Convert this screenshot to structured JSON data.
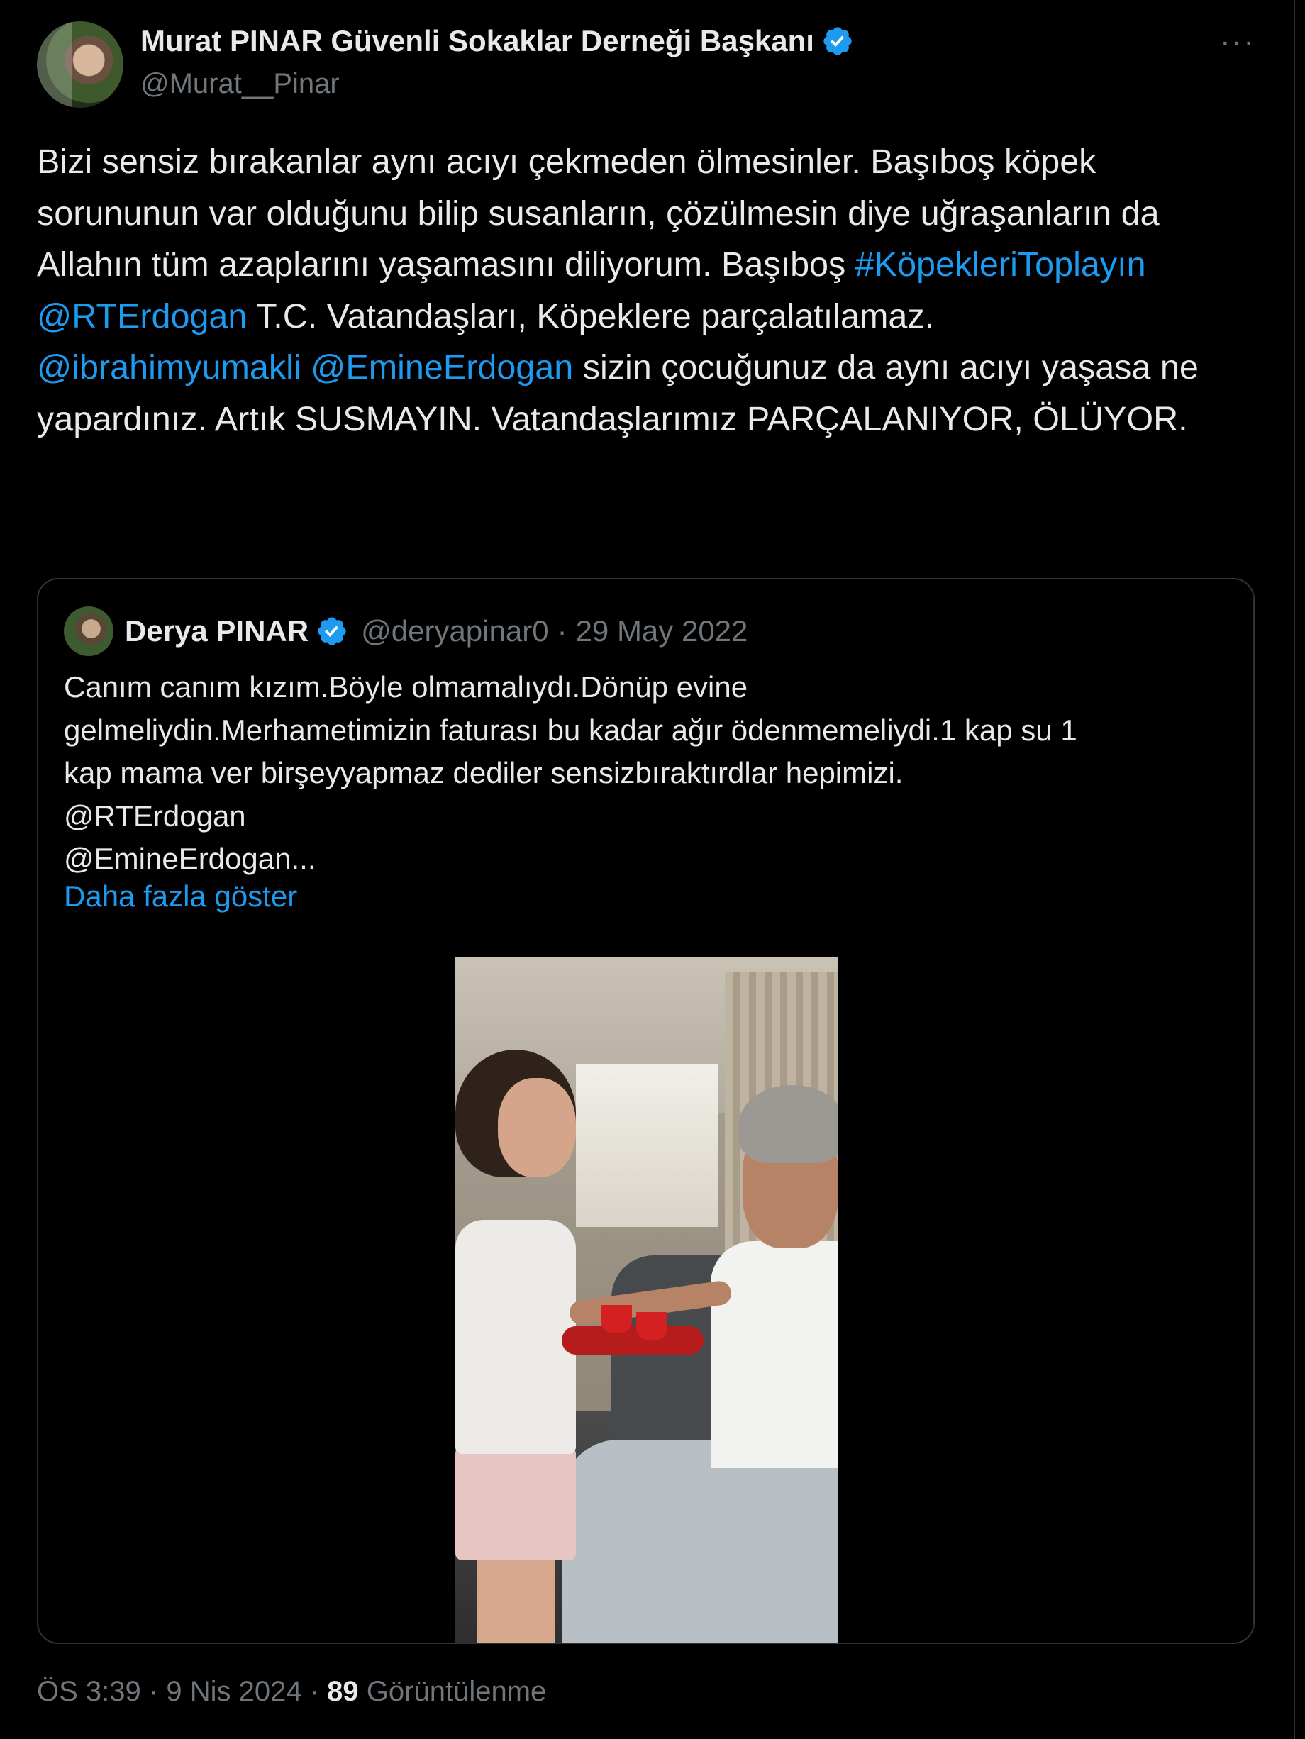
{
  "tweet": {
    "author": {
      "display_name": "Murat PINAR Güvenli Sokaklar Derneği Başkanı",
      "handle": "@Murat__Pinar",
      "verified": true
    },
    "more_label": "···",
    "body": {
      "seg1": "Bizi sensiz bırakanlar aynı acıyı çekmeden ölmesinler. Başıboş köpek sorununun var olduğunu bilip susanların, çözülmesin diye uğraşanların da Allahın tüm azaplarını yaşamasını diliyorum. Başıboş ",
      "hashtag": "#KöpekleriToplayın",
      "mention1": "@RTErdogan",
      "seg2": " T.C. Vatandaşları, Köpeklere parçalatılamaz.",
      "mention2": "@ibrahimyumakli",
      "mention3": "@EmineErdogan",
      "seg3": " sizin çocuğunuz da aynı acıyı yaşasa ne yapardınız. Artık SUSMAYIN. Vatandaşlarımız PARÇALANIYOR, ÖLÜYOR."
    },
    "quote": {
      "display_name": "Derya PINAR",
      "handle": "@deryapinar0",
      "separator": "·",
      "date": "29 May 2022",
      "text_line1": "Canım canım kızım.Böyle olmamalıydı.Dönüp evine",
      "text_line2": "gelmeliydin.Merhametimizin faturası bu kadar ağır ödenmemeliydi.1 kap su 1",
      "text_line3": "kap mama ver birşeyyapmaz dediler sensizbıraktırdlar hepimizi.",
      "text_line4": "@RTErdogan",
      "text_line5": "@EmineErdogan...",
      "show_more": "Daha fazla göster"
    },
    "footer": {
      "time": "ÖS 3:39",
      "sep1": "·",
      "date": "9 Nis 2024",
      "sep2": "·",
      "views": "89",
      "views_label": "Görüntülenme"
    },
    "colors": {
      "background": "#000000",
      "text": "#e7e9ea",
      "secondary": "#71767b",
      "link": "#1d9bf0",
      "border": "#2f3336"
    }
  }
}
